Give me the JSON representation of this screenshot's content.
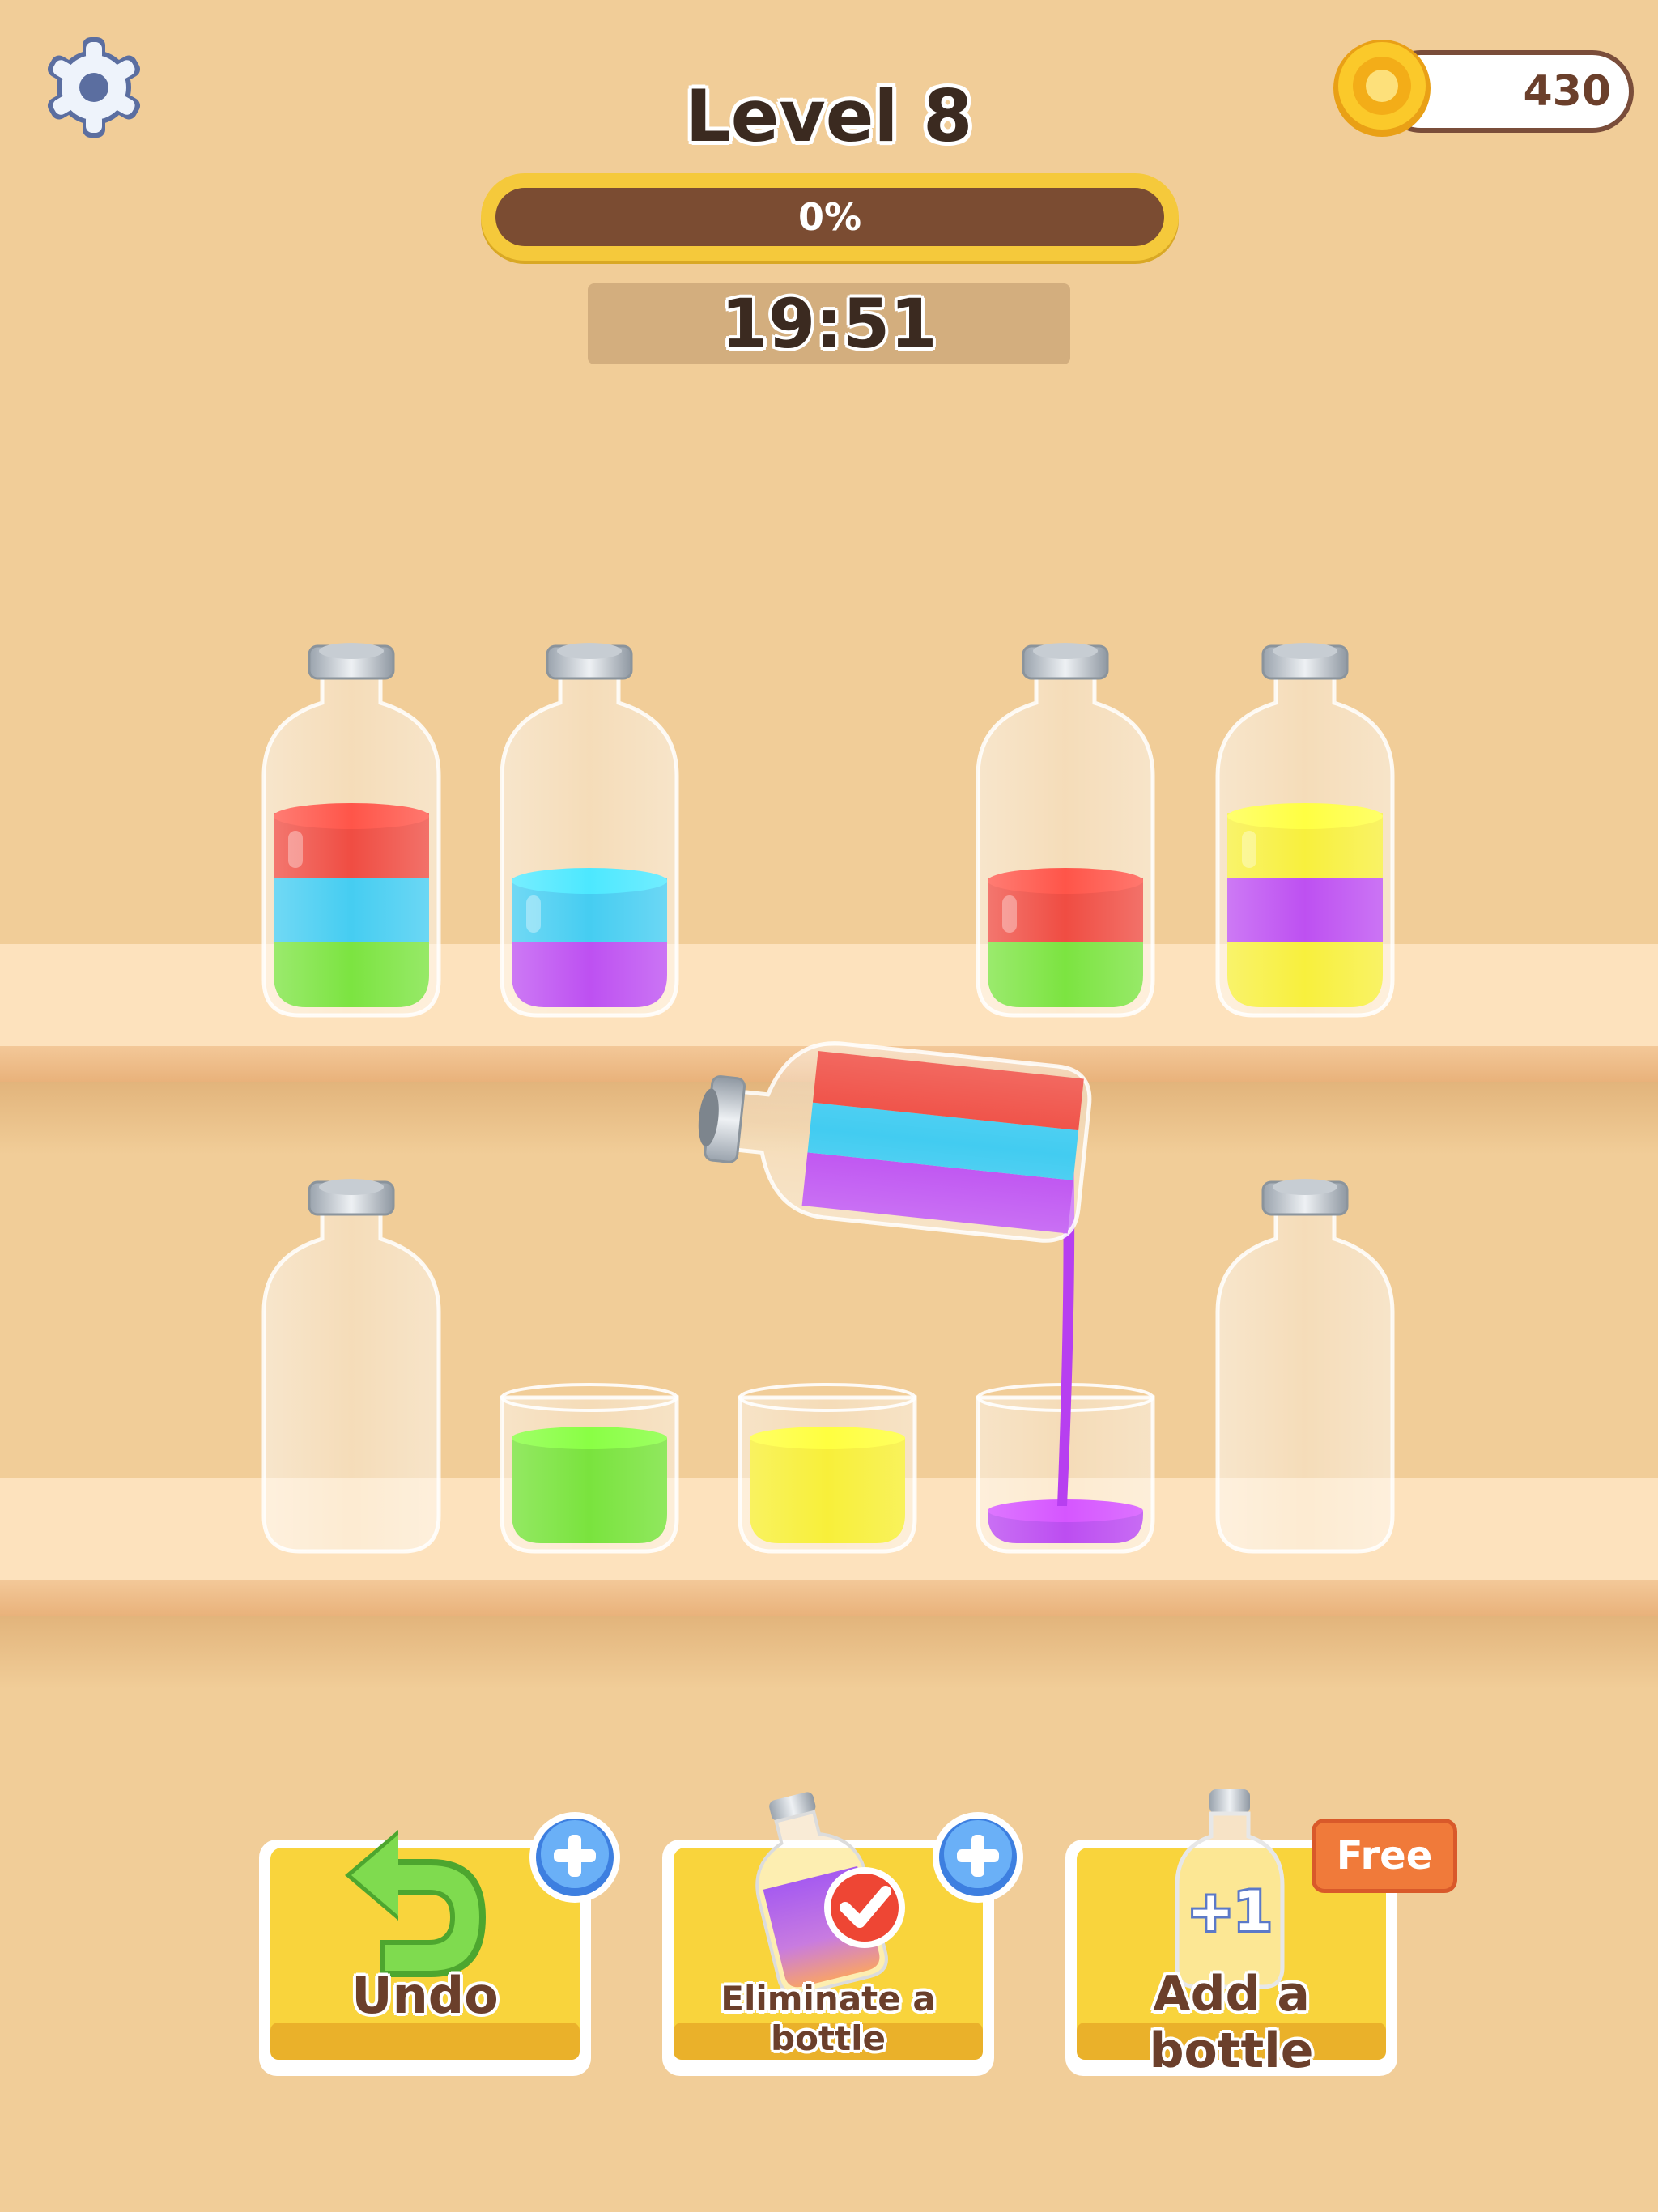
{
  "header": {
    "title": "Level 8",
    "progress_label": "0%",
    "progress_fraction": 0,
    "timer": "19:51",
    "coins": "430"
  },
  "icons": {
    "settings": "gear-icon",
    "coin": "coin-icon",
    "undo": "undo-arrow-icon",
    "plus": "plus-icon",
    "eliminate": "potion-check-icon",
    "add_bottle": "bottle-plus-one-icon"
  },
  "colors": {
    "red": "#ee3b30",
    "blue": "#33c8f0",
    "green": "#6fe12e",
    "purple": "#b73ff0",
    "yellow": "#f7ee2a",
    "background": "#f1cd98"
  },
  "board": {
    "top_shelf": [
      {
        "type": "bottle",
        "layers_top_to_bottom": [
          "red",
          "blue",
          "green"
        ]
      },
      {
        "type": "bottle",
        "layers_top_to_bottom": [
          "blue",
          "purple"
        ]
      },
      {
        "type": "empty-slot",
        "layers_top_to_bottom": []
      },
      {
        "type": "bottle",
        "layers_top_to_bottom": [
          "red",
          "green"
        ]
      },
      {
        "type": "bottle",
        "layers_top_to_bottom": [
          "yellow",
          "purple",
          "yellow"
        ]
      }
    ],
    "bottom_shelf": [
      {
        "type": "bottle",
        "layers_top_to_bottom": []
      },
      {
        "type": "cup",
        "layers_top_to_bottom": [
          "green"
        ]
      },
      {
        "type": "cup",
        "layers_top_to_bottom": [
          "yellow"
        ]
      },
      {
        "type": "cup",
        "layers_top_to_bottom": [
          "purple"
        ]
      },
      {
        "type": "bottle",
        "layers_top_to_bottom": []
      }
    ],
    "pouring_bottle": {
      "layers_from_neck": [
        "purple",
        "blue",
        "red"
      ],
      "pouring_color": "purple"
    }
  },
  "boosters": {
    "undo_label": "Undo",
    "eliminate_label": "Eliminate a bottle",
    "add_label": "Add a bottle",
    "add_badge": "Free",
    "add_icon_text": "+1"
  }
}
